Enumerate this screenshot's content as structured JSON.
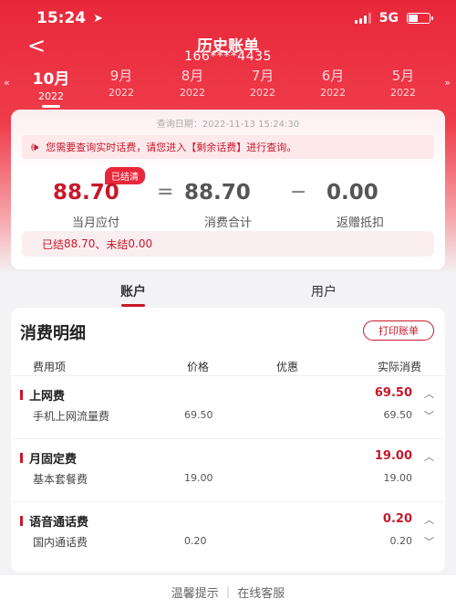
{
  "status": {
    "time": "15:24",
    "network": "5G"
  },
  "nav": {
    "back": "<",
    "title": "历史账单",
    "phone": "166****4435"
  },
  "months": [
    {
      "month": "10月",
      "year": "2022",
      "active": true
    },
    {
      "month": "9月",
      "year": "2022"
    },
    {
      "month": "8月",
      "year": "2022"
    },
    {
      "month": "7月",
      "year": "2022"
    },
    {
      "month": "6月",
      "year": "2022"
    },
    {
      "month": "5月",
      "year": "2022"
    }
  ],
  "summary": {
    "query_date": "查询日期：2022-11-13 15:24:30",
    "notice": "您需要查询实时话费，请您进入【剩余话费】进行查询。",
    "badge": "已结清",
    "due_amount": "88.70",
    "due_label": "当月应付",
    "total_amount": "88.70",
    "total_label": "消费合计",
    "rebate_amount": "0.00",
    "rebate_label": "返赠抵扣",
    "eq": "=",
    "minus": "−",
    "settled_prefix": "已结",
    "settled": "88.70",
    "unsettled_prefix": "、未结",
    "unsettled": "0.00"
  },
  "tabs": {
    "account": "账户",
    "user": "用户"
  },
  "detail": {
    "title": "消费明细",
    "print": "打印账单",
    "headers": {
      "item": "费用项",
      "price": "价格",
      "discount": "优惠",
      "actual": "实际消费"
    },
    "groups": [
      {
        "name": "上网费",
        "total": "69.50",
        "item": "手机上网流量费",
        "price": "69.50",
        "actual": "69.50"
      },
      {
        "name": "月固定费",
        "total": "19.00",
        "item": "基本套餐费",
        "price": "19.00",
        "actual": "19.00"
      },
      {
        "name": "语音通话费",
        "total": "0.20",
        "item": "国内通话费",
        "price": "0.20",
        "actual": "0.20"
      }
    ]
  },
  "footer": {
    "tips": "温馨提示",
    "sep": "|",
    "service": "在线客服"
  },
  "colors": {
    "brand": "#e8283a",
    "accent_text": "#c8182a"
  }
}
